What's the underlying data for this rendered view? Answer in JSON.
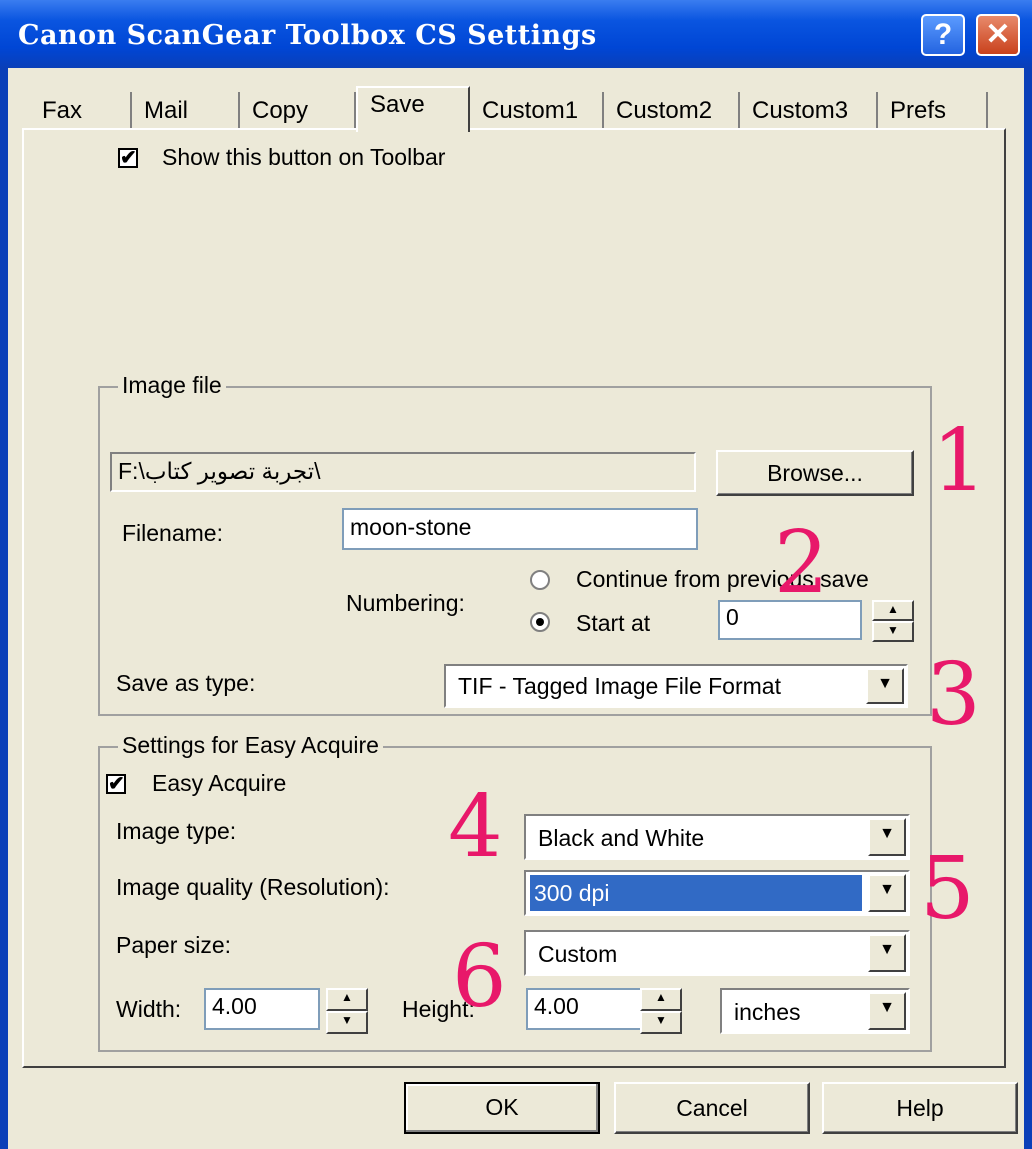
{
  "window": {
    "title": "Canon ScanGear Toolbox CS Settings",
    "help_glyph": "?",
    "close_glyph": "✕"
  },
  "tabs": [
    "Fax",
    "Mail",
    "Copy",
    "Save",
    "Custom1",
    "Custom2",
    "Custom3",
    "Prefs"
  ],
  "active_tab": "Save",
  "show_on_toolbar": {
    "label": "Show this button on Toolbar",
    "checked": true
  },
  "image_file": {
    "group_title": "Image file",
    "path": "F:\\تجربة تصوير كتاب\\",
    "browse_label": "Browse...",
    "filename_label": "Filename:",
    "filename_value": "moon-stone",
    "numbering_label": "Numbering:",
    "continue_label": "Continue from previous save",
    "start_at_label": "Start at",
    "start_at_value": "0",
    "numbering_selected": "Start at",
    "save_as_type_label": "Save as type:",
    "save_as_type_value": "TIF - Tagged Image File Format"
  },
  "easy_acquire": {
    "group_title": "Settings for Easy Acquire",
    "checkbox_label": "Easy Acquire",
    "checked": true,
    "image_type_label": "Image type:",
    "image_type_value": "Black and White",
    "image_quality_label": "Image quality (Resolution):",
    "image_quality_value": "300 dpi",
    "paper_size_label": "Paper size:",
    "paper_size_value": "Custom",
    "width_label": "Width:",
    "width_value": "4.00",
    "height_label": "Height:",
    "height_value": "4.00",
    "units_value": "inches"
  },
  "buttons": {
    "ok": "OK",
    "cancel": "Cancel",
    "help": "Help"
  },
  "annotations": [
    "1",
    "2",
    "3",
    "4",
    "5",
    "6"
  ],
  "annotation_color": "#e8186a",
  "selection_color": "#316ac5"
}
